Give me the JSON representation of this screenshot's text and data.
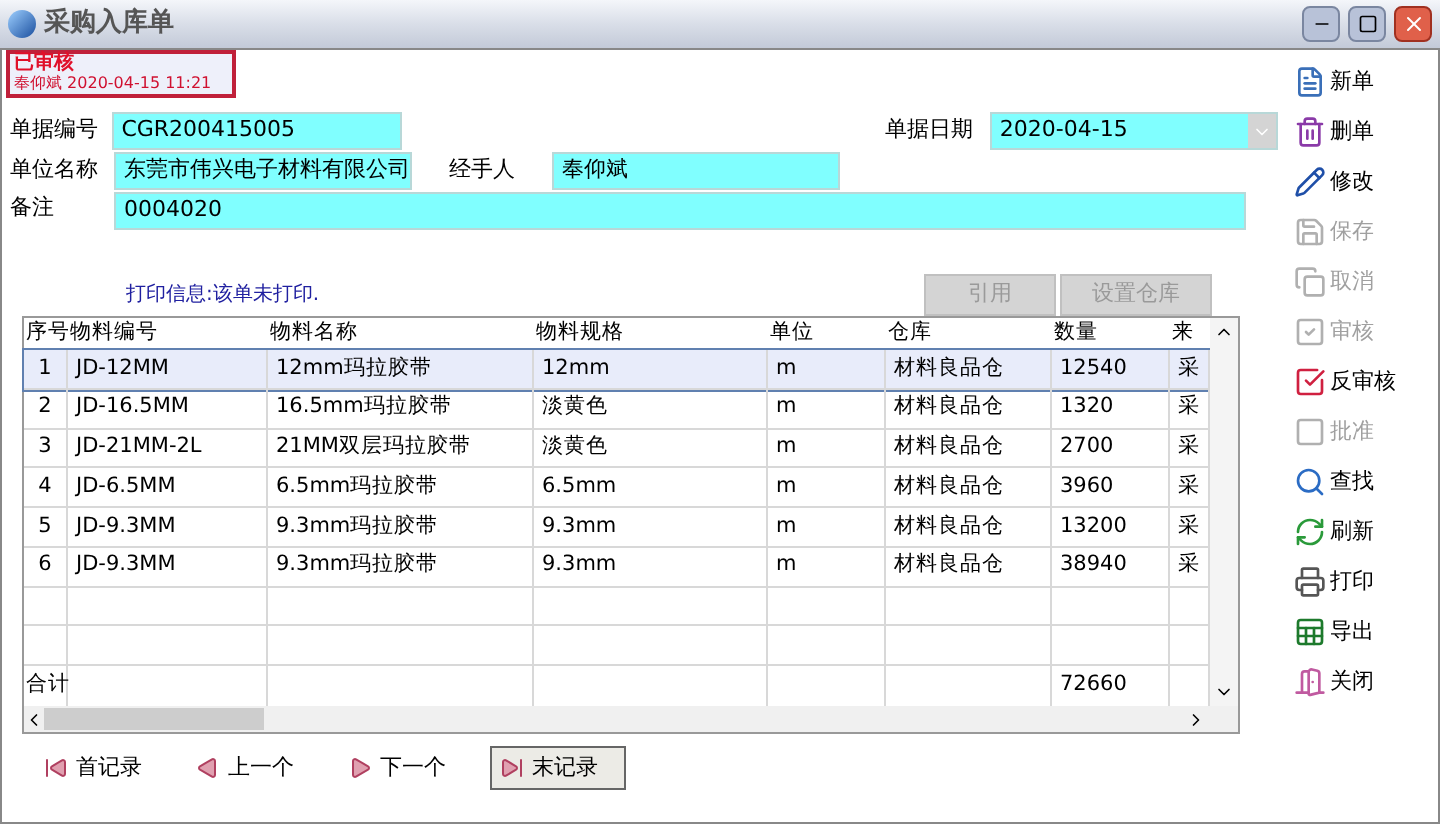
{
  "window": {
    "title": "采购入库单"
  },
  "status": {
    "label": "已审核",
    "detail": "奉仰斌 2020-04-15 11:21"
  },
  "form": {
    "number_label": "单据编号",
    "number": "CGR200415005",
    "date_label": "单据日期",
    "date": "2020-04-15",
    "company_label": "单位名称",
    "company": "东莞市伟兴电子材料有限公司",
    "handler_label": "经手人",
    "handler": "奉仰斌",
    "note_label": "备注",
    "note": "0004020"
  },
  "print_info": "打印信息:该单未打印.",
  "actions": [
    {
      "label": "引用",
      "disabled": true
    },
    {
      "label": "设置仓库",
      "disabled": true
    }
  ],
  "table": {
    "columns": [
      "序号",
      "物料编号",
      "物料名称",
      "物料规格",
      "单位",
      "仓库",
      "数量",
      "来"
    ],
    "rows": [
      {
        "cells": [
          "1",
          "JD-12MM",
          "12mm玛拉胶带",
          "12mm",
          "m",
          "材料良品仓",
          "12540",
          "采"
        ],
        "selected": true
      },
      {
        "cells": [
          "2",
          "JD-16.5MM",
          "16.5mm玛拉胶带",
          "淡黄色",
          "m",
          "材料良品仓",
          "1320",
          "采"
        ],
        "selected": false
      },
      {
        "cells": [
          "3",
          "JD-21MM-2L",
          "21MM双层玛拉胶带",
          "淡黄色",
          "m",
          "材料良品仓",
          "2700",
          "采"
        ],
        "selected": false
      },
      {
        "cells": [
          "4",
          "JD-6.5MM",
          "6.5mm玛拉胶带",
          "6.5mm",
          "m",
          "材料良品仓",
          "3960",
          "采"
        ],
        "selected": false
      },
      {
        "cells": [
          "5",
          "JD-9.3MM",
          "9.3mm玛拉胶带",
          "9.3mm",
          "m",
          "材料良品仓",
          "13200",
          "采"
        ],
        "selected": false
      },
      {
        "cells": [
          "6",
          "JD-9.3MM",
          "9.3mm玛拉胶带",
          "9.3mm",
          "m",
          "材料良品仓",
          "38940",
          "采"
        ],
        "selected": false
      }
    ],
    "total_label": "合计",
    "total_quantity": "72660"
  },
  "navigation": [
    {
      "kind": "first",
      "label": "首记录",
      "selected": false
    },
    {
      "kind": "prev",
      "label": "上一个",
      "selected": false
    },
    {
      "kind": "next",
      "label": "下一个",
      "selected": false
    },
    {
      "kind": "last",
      "label": "末记录",
      "selected": true
    }
  ],
  "toolbar": [
    {
      "kind": "new",
      "label": "新单",
      "disabled": false
    },
    {
      "kind": "delete",
      "label": "删单",
      "disabled": false
    },
    {
      "kind": "edit",
      "label": "修改",
      "disabled": false
    },
    {
      "kind": "save",
      "label": "保存",
      "disabled": true
    },
    {
      "kind": "cancel",
      "label": "取消",
      "disabled": true
    },
    {
      "kind": "audit",
      "label": "审核",
      "disabled": true
    },
    {
      "kind": "unaudit",
      "label": "反审核",
      "disabled": false
    },
    {
      "kind": "approve",
      "label": "批准",
      "disabled": true
    },
    {
      "kind": "find",
      "label": "查找",
      "disabled": false
    },
    {
      "kind": "refresh",
      "label": "刷新",
      "disabled": false
    },
    {
      "kind": "print",
      "label": "打印",
      "disabled": false
    },
    {
      "kind": "export",
      "label": "导出",
      "disabled": false
    },
    {
      "kind": "close",
      "label": "关闭",
      "disabled": false
    }
  ]
}
